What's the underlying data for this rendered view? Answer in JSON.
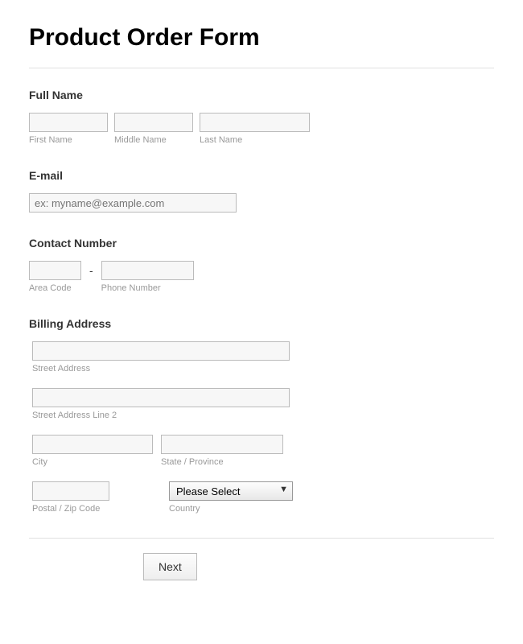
{
  "title": "Product Order Form",
  "fullName": {
    "label": "Full Name",
    "first": {
      "sublabel": "First Name",
      "value": ""
    },
    "middle": {
      "sublabel": "Middle Name",
      "value": ""
    },
    "last": {
      "sublabel": "Last Name",
      "value": ""
    }
  },
  "email": {
    "label": "E-mail",
    "placeholder": "ex: myname@example.com",
    "value": ""
  },
  "contact": {
    "label": "Contact Number",
    "areaCode": {
      "sublabel": "Area Code",
      "value": ""
    },
    "phone": {
      "sublabel": "Phone Number",
      "value": ""
    },
    "dash": "-"
  },
  "billing": {
    "label": "Billing Address",
    "street": {
      "sublabel": "Street Address",
      "value": ""
    },
    "street2": {
      "sublabel": "Street Address Line 2",
      "value": ""
    },
    "city": {
      "sublabel": "City",
      "value": ""
    },
    "state": {
      "sublabel": "State / Province",
      "value": ""
    },
    "postal": {
      "sublabel": "Postal / Zip Code",
      "value": ""
    },
    "country": {
      "sublabel": "Country",
      "selected": "Please Select"
    }
  },
  "nextButton": "Next"
}
